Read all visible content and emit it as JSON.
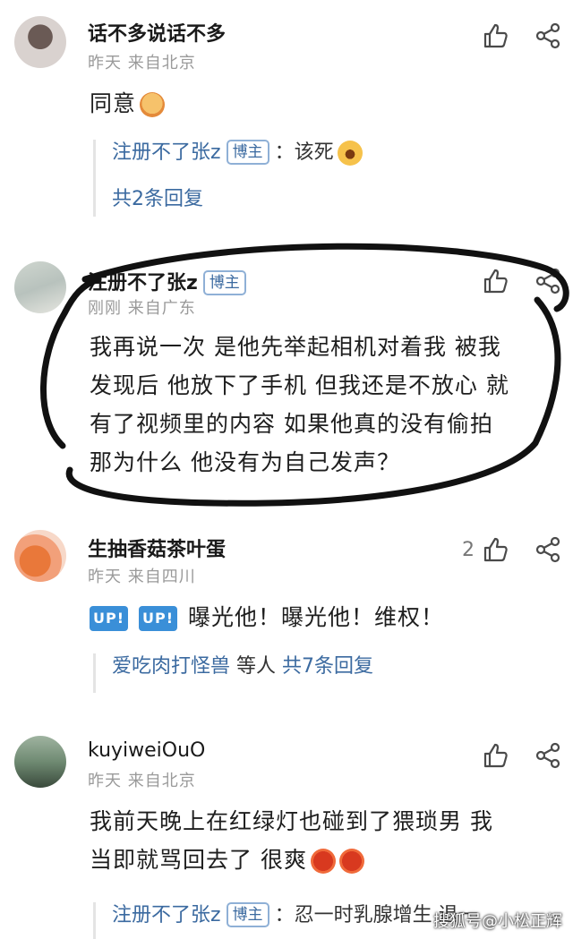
{
  "comments": [
    {
      "name": "话不多说话不多",
      "meta": "昨天  来自北京",
      "text": "同意",
      "reply": {
        "user": "注册不了张z",
        "badge": "博主",
        "sep": "：",
        "text": "该死",
        "count": "共2条回复"
      }
    },
    {
      "name": "注册不了张z",
      "badge": "博主",
      "meta": "刚刚  来自广东",
      "lines": [
        "我再说一次 是他先举起相机对着我 被我",
        "发现后 他放下了手机 但我还是不放心 就",
        "有了视频里的内容 如果他真的没有偷拍",
        "那为什么 他没有为自己发声？"
      ]
    },
    {
      "name": "生抽香菇茶叶蛋",
      "meta": "昨天  来自四川",
      "likes": "2",
      "tags": [
        "UP!",
        "UP!"
      ],
      "text": "曝光他！曝光他！维权！",
      "reply": {
        "user": "爱吃肉打怪兽",
        "plain": " 等人 ",
        "count": "共7条回复"
      }
    },
    {
      "name": "kuyiweiOuO",
      "meta": "昨天  来自北京",
      "lines": [
        "我前天晚上在红绿灯也碰到了猥琐男 我",
        "当即就骂回去了 很爽"
      ],
      "reply": {
        "user": "注册不了张z",
        "badge": "博主",
        "sep": "：",
        "text": "忍一时乳腺增生 退一"
      }
    }
  ],
  "icons": [
    "like-icon",
    "share-icon",
    "avatar",
    "emoji"
  ],
  "colors": {
    "link": "#3b6aa0",
    "meta": "#9a9a9a",
    "badge_border": "#8fb0d6",
    "up_tag": "#3a8fd8"
  },
  "watermark": "搜狐号@小松正辉"
}
